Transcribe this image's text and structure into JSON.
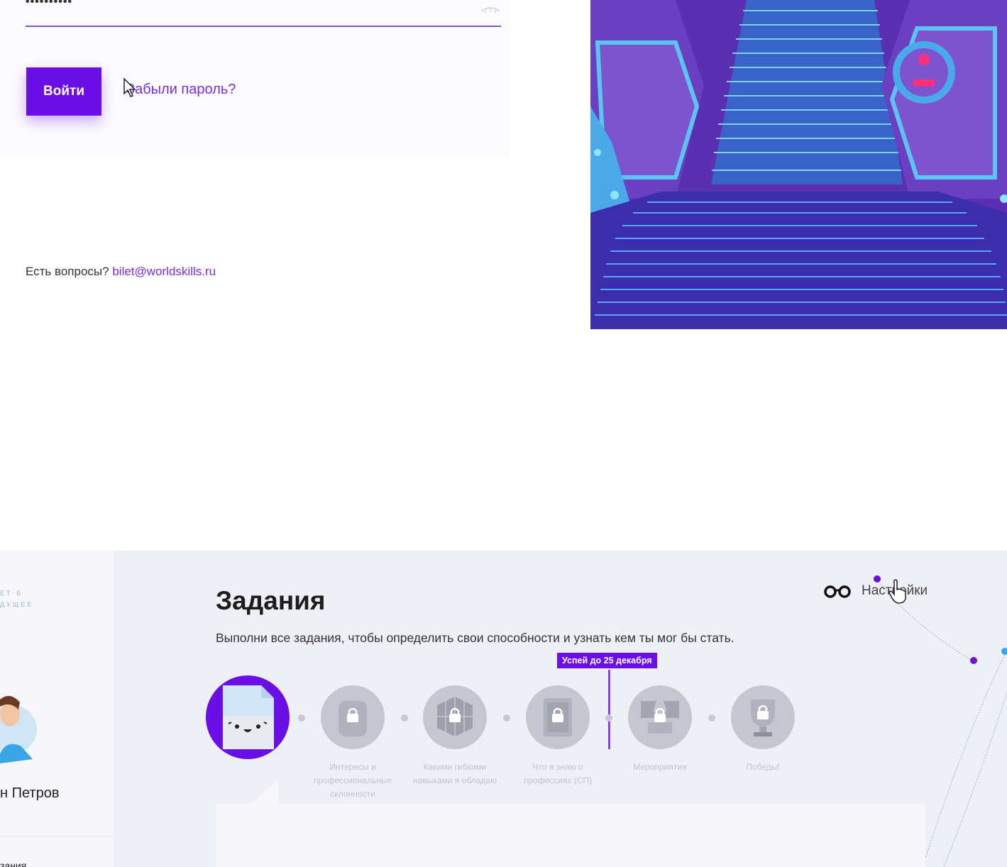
{
  "login": {
    "password_value": "••••••••••",
    "submit_label": "Войти",
    "forgot_label": "Забыли пароль?",
    "questions_text": "Есть вопросы?",
    "support_email": "bilet@worldskills.ru"
  },
  "colors": {
    "accent": "#6a0fe6",
    "link": "#7a2de0"
  },
  "sidebar": {
    "logo_lines": [
      "ЕТ·Б",
      "ДУЩЕЕ"
    ],
    "user_name": "н Петров",
    "menu_item": "зания"
  },
  "tasks": {
    "title": "Задания",
    "subtitle": "Выполни все задания, чтобы определить свои способности и узнать кем ты мог бы стать.",
    "settings_label": "Настройки",
    "settings_icon": "glasses-icon",
    "deadline": "Успей до 25 декабря",
    "steps": [
      {
        "label": "",
        "icon": "document-mascot-icon",
        "locked": false
      },
      {
        "label": "Интересы и профессиональные склонности",
        "icon": "backpack-lock-icon",
        "locked": true
      },
      {
        "label": "Какими гибкими навыками я обладаю",
        "icon": "cube-lock-icon",
        "locked": true
      },
      {
        "label": "Что я знаю о профессиях (СП)",
        "icon": "book-lock-icon",
        "locked": true
      },
      {
        "label": "Мероприятия",
        "icon": "flags-lock-icon",
        "locked": true
      },
      {
        "label": "Победы!",
        "icon": "trophy-lock-icon",
        "locked": true
      }
    ]
  }
}
